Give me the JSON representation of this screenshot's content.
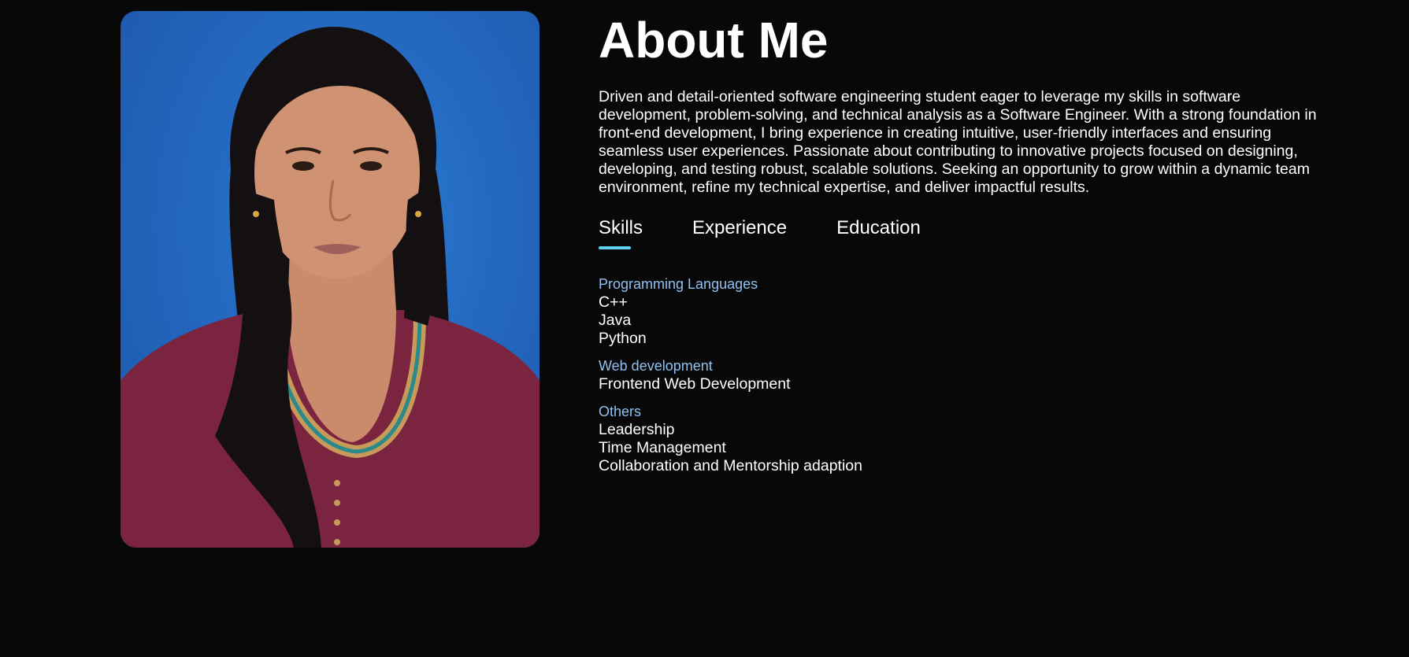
{
  "about": {
    "title": "About Me",
    "bio": "Driven and detail-oriented software engineering student eager to leverage my skills in software development, problem-solving, and technical analysis as a Software Engineer. With a strong foundation in front-end development, I bring experience in creating intuitive, user-friendly interfaces and ensuring seamless user experiences. Passionate about contributing to innovative projects focused on designing, developing, and testing robust, scalable solutions. Seeking an opportunity to grow within a dynamic team environment, refine my technical expertise, and deliver impactful results."
  },
  "tabs": [
    {
      "label": "Skills",
      "active": true
    },
    {
      "label": "Experience",
      "active": false
    },
    {
      "label": "Education",
      "active": false
    }
  ],
  "skills": [
    {
      "title": "Programming Languages",
      "items": [
        "C++",
        "Java",
        "Python"
      ]
    },
    {
      "title": "Web development",
      "items": [
        "Frontend Web Development"
      ]
    },
    {
      "title": "Others",
      "items": [
        "Leadership",
        "Time Management",
        "Collaboration and Mentorship adaption"
      ]
    }
  ],
  "colors": {
    "background": "#080808",
    "accent_underline": "#5fd0f0",
    "group_title": "#8fc0f0",
    "photo_background": "#2468c0"
  }
}
